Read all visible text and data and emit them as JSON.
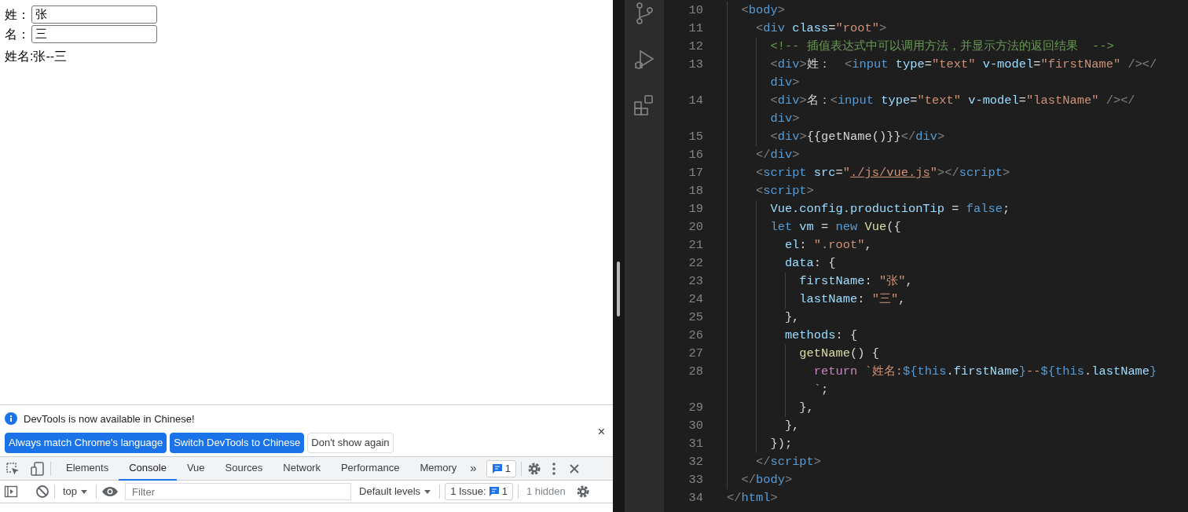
{
  "page": {
    "fields": [
      {
        "label": "姓：",
        "value": "张"
      },
      {
        "label": "名：",
        "value": "三"
      }
    ],
    "output": "姓名:张--三"
  },
  "devtools": {
    "infobar": {
      "message": "DevTools is now available in Chinese!",
      "buttons": [
        {
          "label": "Always match Chrome's language",
          "kind": "primary"
        },
        {
          "label": "Switch DevTools to Chinese",
          "kind": "primary"
        },
        {
          "label": "Don't show again",
          "kind": "secondary"
        }
      ],
      "close": "×"
    },
    "tabs": [
      {
        "label": "Elements",
        "selected": false
      },
      {
        "label": "Console",
        "selected": true
      },
      {
        "label": "Vue",
        "selected": false
      },
      {
        "label": "Sources",
        "selected": false
      },
      {
        "label": "Network",
        "selected": false
      },
      {
        "label": "Performance",
        "selected": false
      },
      {
        "label": "Memory",
        "selected": false
      }
    ],
    "more": "»",
    "issues_badge": "1",
    "console_toolbar": {
      "context": "top",
      "filter_placeholder": "Filter",
      "levels": "Default levels",
      "issues_label": "1 Issue:",
      "issues_count": "1",
      "hidden": "1 hidden"
    }
  },
  "editor": {
    "rows": [
      {
        "number": "10",
        "tokens": [
          {
            "kind": "punct",
            "text": "  <"
          },
          {
            "kind": "tag",
            "text": "body"
          },
          {
            "kind": "punct",
            "text": ">"
          }
        ]
      },
      {
        "number": "11",
        "tokens": [
          {
            "kind": "punct",
            "text": "    <"
          },
          {
            "kind": "tag",
            "text": "div"
          },
          {
            "kind": "attr",
            "text": " class"
          },
          {
            "kind": "text",
            "text": "="
          },
          {
            "kind": "str",
            "text": "\"root\""
          },
          {
            "kind": "punct",
            "text": ">"
          }
        ]
      },
      {
        "number": "12",
        "tokens": [
          {
            "kind": "comment",
            "text": "      <!-- 插值表达式中可以调用方法，并显示方法的返回结果  -->"
          }
        ]
      },
      {
        "number": "13",
        "tokens": [
          {
            "kind": "punct",
            "text": "      <"
          },
          {
            "kind": "tag",
            "text": "div"
          },
          {
            "kind": "punct",
            "text": ">"
          },
          {
            "kind": "text",
            "text": "姓：  "
          },
          {
            "kind": "punct",
            "text": "<"
          },
          {
            "kind": "tag",
            "text": "input"
          },
          {
            "kind": "attr",
            "text": " type"
          },
          {
            "kind": "text",
            "text": "="
          },
          {
            "kind": "str",
            "text": "\"text\""
          },
          {
            "kind": "attr",
            "text": " v-model"
          },
          {
            "kind": "text",
            "text": "="
          },
          {
            "kind": "str",
            "text": "\"firstName\""
          },
          {
            "kind": "punct",
            "text": " /></"
          }
        ]
      },
      {
        "tokens": [
          {
            "kind": "tag",
            "text": "      div"
          },
          {
            "kind": "punct",
            "text": ">"
          }
        ]
      },
      {
        "number": "14",
        "tokens": [
          {
            "kind": "punct",
            "text": "      <"
          },
          {
            "kind": "tag",
            "text": "div"
          },
          {
            "kind": "punct",
            "text": ">"
          },
          {
            "kind": "text",
            "text": "名："
          },
          {
            "kind": "punct",
            "text": "<"
          },
          {
            "kind": "tag",
            "text": "input"
          },
          {
            "kind": "attr",
            "text": " type"
          },
          {
            "kind": "text",
            "text": "="
          },
          {
            "kind": "str",
            "text": "\"text\""
          },
          {
            "kind": "attr",
            "text": " v-model"
          },
          {
            "kind": "text",
            "text": "="
          },
          {
            "kind": "str",
            "text": "\"lastName\""
          },
          {
            "kind": "punct",
            "text": " /></"
          }
        ]
      },
      {
        "tokens": [
          {
            "kind": "tag",
            "text": "      div"
          },
          {
            "kind": "punct",
            "text": ">"
          }
        ]
      },
      {
        "number": "15",
        "tokens": [
          {
            "kind": "punct",
            "text": "      <"
          },
          {
            "kind": "tag",
            "text": "div"
          },
          {
            "kind": "punct",
            "text": ">"
          },
          {
            "kind": "text",
            "text": "{{getName()}}"
          },
          {
            "kind": "punct",
            "text": "</"
          },
          {
            "kind": "tag",
            "text": "div"
          },
          {
            "kind": "punct",
            "text": ">"
          }
        ]
      },
      {
        "number": "16",
        "tokens": [
          {
            "kind": "punct",
            "text": "    </"
          },
          {
            "kind": "tag",
            "text": "div"
          },
          {
            "kind": "punct",
            "text": ">"
          }
        ]
      },
      {
        "number": "17",
        "tokens": [
          {
            "kind": "punct",
            "text": "    <"
          },
          {
            "kind": "tag",
            "text": "script"
          },
          {
            "kind": "attr",
            "text": " src"
          },
          {
            "kind": "text",
            "text": "="
          },
          {
            "kind": "str",
            "text": "\""
          },
          {
            "kind": "link",
            "text": "./js/vue.js"
          },
          {
            "kind": "str",
            "text": "\""
          },
          {
            "kind": "punct",
            "text": "></"
          },
          {
            "kind": "tag",
            "text": "script"
          },
          {
            "kind": "punct",
            "text": ">"
          }
        ]
      },
      {
        "number": "18",
        "tokens": [
          {
            "kind": "punct",
            "text": "    <"
          },
          {
            "kind": "tag",
            "text": "script"
          },
          {
            "kind": "punct",
            "text": ">"
          }
        ]
      },
      {
        "number": "19",
        "tokens": [
          {
            "kind": "var",
            "text": "      Vue.config.productionTip"
          },
          {
            "kind": "text",
            "text": " = "
          },
          {
            "kind": "kw",
            "text": "false"
          },
          {
            "kind": "text",
            "text": ";"
          }
        ]
      },
      {
        "number": "20",
        "tokens": [
          {
            "kind": "kw",
            "text": "      let"
          },
          {
            "kind": "var",
            "text": " vm"
          },
          {
            "kind": "text",
            "text": " = "
          },
          {
            "kind": "kw",
            "text": "new"
          },
          {
            "kind": "fn",
            "text": " Vue"
          },
          {
            "kind": "text",
            "text": "({"
          }
        ]
      },
      {
        "number": "21",
        "tokens": [
          {
            "kind": "var",
            "text": "        el"
          },
          {
            "kind": "text",
            "text": ": "
          },
          {
            "kind": "str",
            "text": "\".root\""
          },
          {
            "kind": "text",
            "text": ","
          }
        ]
      },
      {
        "number": "22",
        "tokens": [
          {
            "kind": "var",
            "text": "        data"
          },
          {
            "kind": "text",
            "text": ": {"
          }
        ]
      },
      {
        "number": "23",
        "tokens": [
          {
            "kind": "var",
            "text": "          firstName"
          },
          {
            "kind": "text",
            "text": ": "
          },
          {
            "kind": "str",
            "text": "\"张\""
          },
          {
            "kind": "text",
            "text": ","
          }
        ]
      },
      {
        "number": "24",
        "tokens": [
          {
            "kind": "var",
            "text": "          lastName"
          },
          {
            "kind": "text",
            "text": ": "
          },
          {
            "kind": "str",
            "text": "\"三\""
          },
          {
            "kind": "text",
            "text": ","
          }
        ]
      },
      {
        "number": "25",
        "tokens": [
          {
            "kind": "text",
            "text": "        },"
          }
        ]
      },
      {
        "number": "26",
        "tokens": [
          {
            "kind": "var",
            "text": "        methods"
          },
          {
            "kind": "text",
            "text": ": {"
          }
        ]
      },
      {
        "number": "27",
        "tokens": [
          {
            "kind": "fn",
            "text": "          getName"
          },
          {
            "kind": "text",
            "text": "() {"
          }
        ]
      },
      {
        "number": "28",
        "tokens": [
          {
            "kind": "ctrl",
            "text": "            return"
          },
          {
            "kind": "str",
            "text": " `姓名:"
          },
          {
            "kind": "kw",
            "text": "${"
          },
          {
            "kind": "kw",
            "text": "this"
          },
          {
            "kind": "text",
            "text": "."
          },
          {
            "kind": "var",
            "text": "firstName"
          },
          {
            "kind": "kw",
            "text": "}"
          },
          {
            "kind": "str",
            "text": "--"
          },
          {
            "kind": "kw",
            "text": "${"
          },
          {
            "kind": "kw",
            "text": "this"
          },
          {
            "kind": "text",
            "text": "."
          },
          {
            "kind": "var",
            "text": "lastName"
          },
          {
            "kind": "kw",
            "text": "}"
          }
        ]
      },
      {
        "tokens": [
          {
            "kind": "str",
            "text": "            `"
          },
          {
            "kind": "text",
            "text": ";"
          }
        ]
      },
      {
        "number": "29",
        "tokens": [
          {
            "kind": "text",
            "text": "          },"
          }
        ]
      },
      {
        "number": "30",
        "tokens": [
          {
            "kind": "text",
            "text": "        },"
          }
        ]
      },
      {
        "number": "31",
        "tokens": [
          {
            "kind": "text",
            "text": "      });"
          }
        ]
      },
      {
        "number": "32",
        "tokens": [
          {
            "kind": "punct",
            "text": "    </"
          },
          {
            "kind": "tag",
            "text": "script"
          },
          {
            "kind": "punct",
            "text": ">"
          }
        ]
      },
      {
        "number": "33",
        "tokens": [
          {
            "kind": "punct",
            "text": "  </"
          },
          {
            "kind": "tag",
            "text": "body"
          },
          {
            "kind": "punct",
            "text": ">"
          }
        ]
      },
      {
        "number": "34",
        "tokens": [
          {
            "kind": "punct",
            "text": "</"
          },
          {
            "kind": "tag",
            "text": "html"
          },
          {
            "kind": "punct",
            "text": ">"
          }
        ]
      }
    ]
  }
}
